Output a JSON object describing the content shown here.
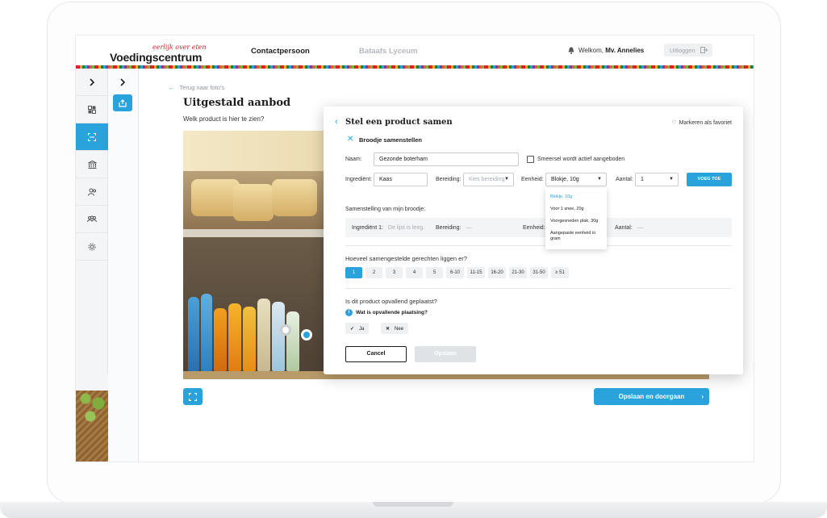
{
  "header": {
    "logo_tagline": "eerlijk over eten",
    "logo_name": "Voedingscentrum",
    "nav_contact": "Contactpersoon",
    "nav_school": "Bataafs Lyceum",
    "welcome_prefix": "Welkom, ",
    "welcome_name": "Mv. Annelies",
    "logout_label": "Uitloggen"
  },
  "main": {
    "back_label": "Terug naar foto's",
    "title": "Uitgestald aanbod",
    "subtitle": "Welk product is hier te zien?",
    "save_continue_label": "Opslaan en doorgaan"
  },
  "modal": {
    "title": "Stel een product samen",
    "favorite_label": "Markeren als favoriet",
    "section_label": "Broodje samenstellen",
    "name_label": "Naam:",
    "name_value": "Gezonde boterham",
    "actively_offered_label": "Smeersel wordt actief aangeboden",
    "ingredient_label": "Ingrediënt:",
    "ingredient_value": "Kaas",
    "preparation_label": "Bereiding:",
    "preparation_placeholder": "Kies bereiding",
    "unit_label": "Eenheid:",
    "unit_value": "Blokje, 10g",
    "amount_label": "Aantal:",
    "amount_value": "1",
    "add_label": "VOEG TOE",
    "unit_options": [
      "Blokje, 10g",
      "Voor 1 snee, 20g",
      "Voorgesneden plak, 30g",
      "Aangepaste eenheid in gram"
    ],
    "composition_title": "Samenstelling van mijn broodje:",
    "composition": {
      "ingredient_label": "Ingrediënt 1:",
      "ingredient_value": "De lijst is leeg.",
      "preparation_label": "Bereiding:",
      "preparation_value": "—",
      "unit_label": "Eenheid:",
      "amount_label": "Aantal:",
      "amount_value": "—"
    },
    "count_question": "Hoeveel samengestelde gerechten liggen er?",
    "count_options": [
      "1",
      "2",
      "3",
      "4",
      "5",
      "6-10",
      "11-15",
      "16-20",
      "21-30",
      "31-50",
      "≥ 51"
    ],
    "count_selected": "1",
    "prominent_question": "Is dit product opvallend geplaatst?",
    "prominent_info": "Wat is opvallende plaatsing?",
    "yes_label": "Ja",
    "no_label": "Nee",
    "cancel_label": "Cancel",
    "save_label": "Opslaan"
  },
  "colors": {
    "accent": "#2aa3dc",
    "brand_red": "#d8232a"
  }
}
